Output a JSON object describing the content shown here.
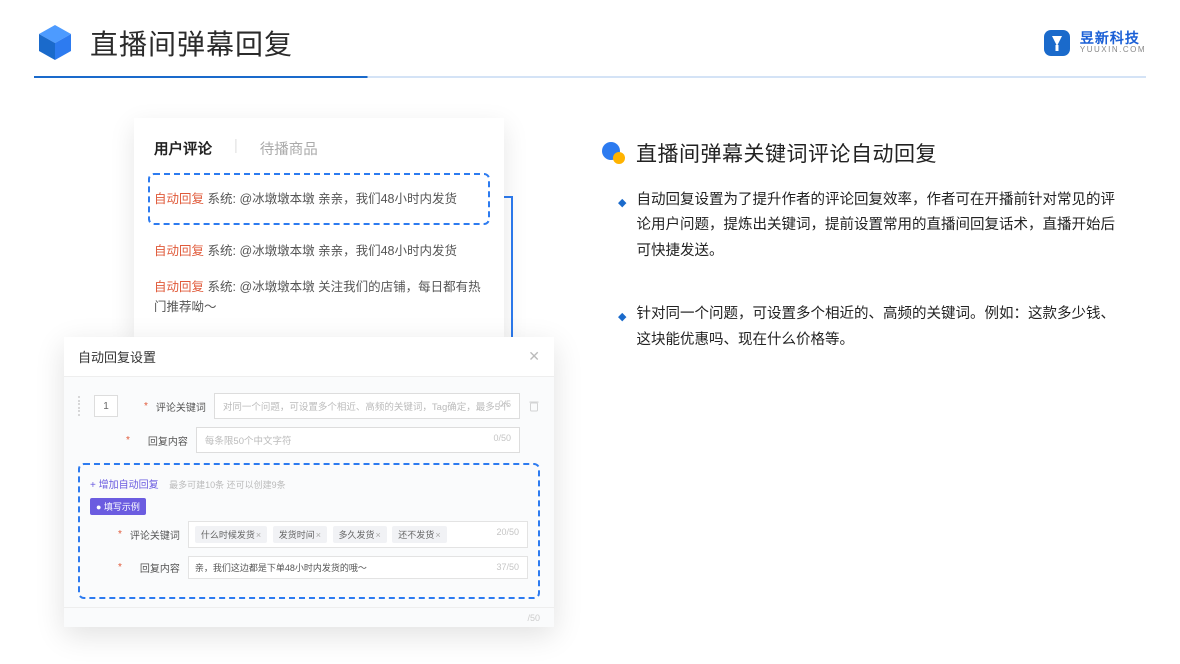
{
  "header": {
    "title": "直播间弹幕回复",
    "brand_cn": "昱新科技",
    "brand_en": "YUUXIN.COM"
  },
  "left": {
    "tabs": {
      "active": "用户评论",
      "inactive": "待播商品"
    },
    "highlight_comment": "系统: @冰墩墩本墩 亲亲，我们48小时内发货",
    "comments": [
      "系统: @冰墩墩本墩 亲亲，我们48小时内发货",
      "系统: @冰墩墩本墩 关注我们的店铺，每日都有热门推荐呦～"
    ],
    "auto_reply_badge": "自动回复",
    "settings": {
      "title": "自动回复设置",
      "num": "1",
      "label_keyword": "评论关键词",
      "placeholder_keyword": "对同一个问题，可设置多个相近、高频的关键词，Tag确定，最多5个",
      "count_keyword": "0/5",
      "label_content": "回复内容",
      "placeholder_content": "每条限50个中文字符",
      "count_content": "0/50",
      "add_link": "+ 增加自动回复",
      "add_hint": "最多可建10条 还可以创建9条",
      "example_badge": "● 填写示例",
      "ex_label_kw": "评论关键词",
      "ex_tags": [
        "什么时候发货",
        "发货时间",
        "多久发货",
        "还不发货"
      ],
      "ex_count_kw": "20/50",
      "ex_label_ct": "回复内容",
      "ex_content": "亲，我们这边都是下单48小时内发货的哦～",
      "ex_count_ct": "37/50",
      "footer_count": "/50"
    }
  },
  "right": {
    "section_title": "直播间弹幕关键词评论自动回复",
    "bullets": [
      "自动回复设置为了提升作者的评论回复效率，作者可在开播前针对常见的评论用户问题，提炼出关键词，提前设置常用的直播间回复话术，直播开始后可快捷发送。",
      "针对同一个问题，可设置多个相近的、高频的关键词。例如：这款多少钱、这块能优惠吗、现在什么价格等。"
    ]
  }
}
